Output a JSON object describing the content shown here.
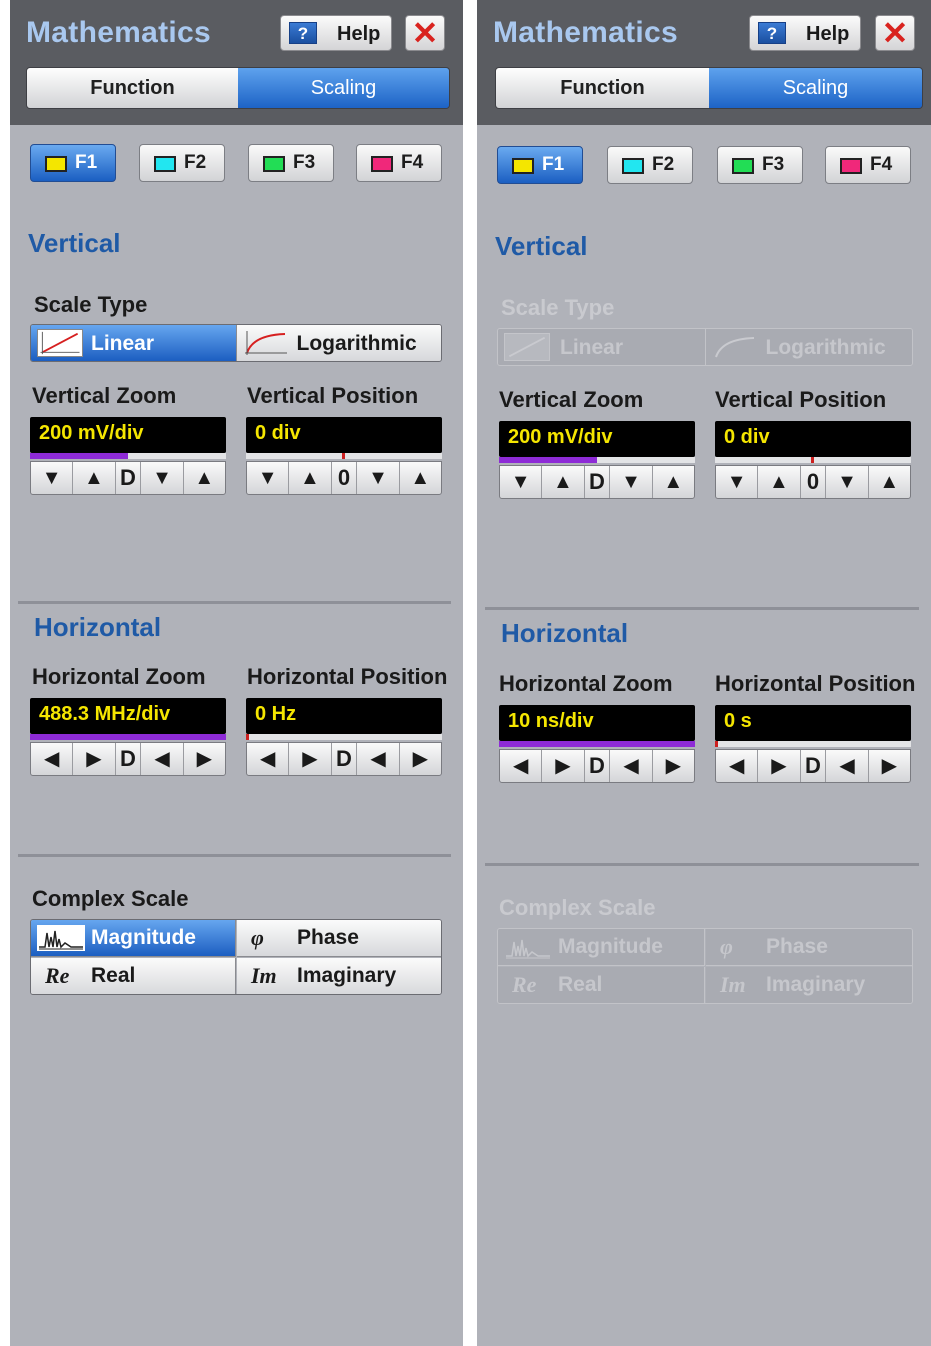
{
  "panels": [
    {
      "title": "Mathematics",
      "help_label": "Help",
      "help_icon": "?",
      "close_icon": "✕",
      "tabs": [
        "Function",
        "Scaling"
      ],
      "active_tab": "Scaling",
      "functions": [
        {
          "label": "F1",
          "color": "#f4e600",
          "active": true
        },
        {
          "label": "F2",
          "color": "#22e6f0",
          "active": false
        },
        {
          "label": "F3",
          "color": "#22dd55",
          "active": false
        },
        {
          "label": "F4",
          "color": "#f0287a",
          "active": false
        }
      ],
      "vertical": {
        "heading": "Vertical",
        "scale_type_label": "Scale Type",
        "scale_type_enabled": true,
        "scale_options": [
          "Linear",
          "Logarithmic"
        ],
        "scale_selected": "Linear",
        "zoom_label": "Vertical Zoom",
        "zoom_value": "200 mV/div",
        "zoom_fill_fraction": 0.5,
        "zoom_steps": [
          "▼",
          "▲",
          "D",
          "▼",
          "▲"
        ],
        "position_label": "Vertical Position",
        "position_value": "0 div",
        "position_steps": [
          "▼",
          "▲",
          "0",
          "▼",
          "▲"
        ]
      },
      "horizontal": {
        "heading": "Horizontal",
        "zoom_label": "Horizontal Zoom",
        "zoom_value": "488.3 MHz/div",
        "zoom_fill_fraction": 1.0,
        "zoom_steps": [
          "◀",
          "▶",
          "D",
          "◀",
          "▶"
        ],
        "position_label": "Horizontal Position",
        "position_value": "0 Hz",
        "position_steps": [
          "◀",
          "▶",
          "D",
          "◀",
          "▶"
        ]
      },
      "complex": {
        "label": "Complex Scale",
        "enabled": true,
        "options": [
          {
            "sym": "",
            "label": "Magnitude",
            "active": true
          },
          {
            "sym": "φ",
            "label": "Phase",
            "active": false
          },
          {
            "sym": "Re",
            "label": "Real",
            "active": false
          },
          {
            "sym": "Im",
            "label": "Imaginary",
            "active": false
          }
        ]
      }
    },
    {
      "title": "Mathematics",
      "help_label": "Help",
      "help_icon": "?",
      "close_icon": "✕",
      "tabs": [
        "Function",
        "Scaling"
      ],
      "active_tab": "Scaling",
      "functions": [
        {
          "label": "F1",
          "color": "#f4e600",
          "active": true
        },
        {
          "label": "F2",
          "color": "#22e6f0",
          "active": false
        },
        {
          "label": "F3",
          "color": "#22dd55",
          "active": false
        },
        {
          "label": "F4",
          "color": "#f0287a",
          "active": false
        }
      ],
      "vertical": {
        "heading": "Vertical",
        "scale_type_label": "Scale Type",
        "scale_type_enabled": false,
        "scale_options": [
          "Linear",
          "Logarithmic"
        ],
        "scale_selected": "",
        "zoom_label": "Vertical Zoom",
        "zoom_value": "200 mV/div",
        "zoom_fill_fraction": 0.5,
        "zoom_steps": [
          "▼",
          "▲",
          "D",
          "▼",
          "▲"
        ],
        "position_label": "Vertical Position",
        "position_value": "0 div",
        "position_steps": [
          "▼",
          "▲",
          "0",
          "▼",
          "▲"
        ]
      },
      "horizontal": {
        "heading": "Horizontal",
        "zoom_label": "Horizontal Zoom",
        "zoom_value": "10 ns/div",
        "zoom_fill_fraction": 1.0,
        "zoom_steps": [
          "◀",
          "▶",
          "D",
          "◀",
          "▶"
        ],
        "position_label": "Horizontal Position",
        "position_value": "0 s",
        "position_steps": [
          "◀",
          "▶",
          "D",
          "◀",
          "▶"
        ]
      },
      "complex": {
        "label": "Complex Scale",
        "enabled": false,
        "options": [
          {
            "sym": "",
            "label": "Magnitude",
            "active": false
          },
          {
            "sym": "φ",
            "label": "Phase",
            "active": false
          },
          {
            "sym": "Re",
            "label": "Real",
            "active": false
          },
          {
            "sym": "Im",
            "label": "Imaginary",
            "active": false
          }
        ]
      }
    }
  ]
}
